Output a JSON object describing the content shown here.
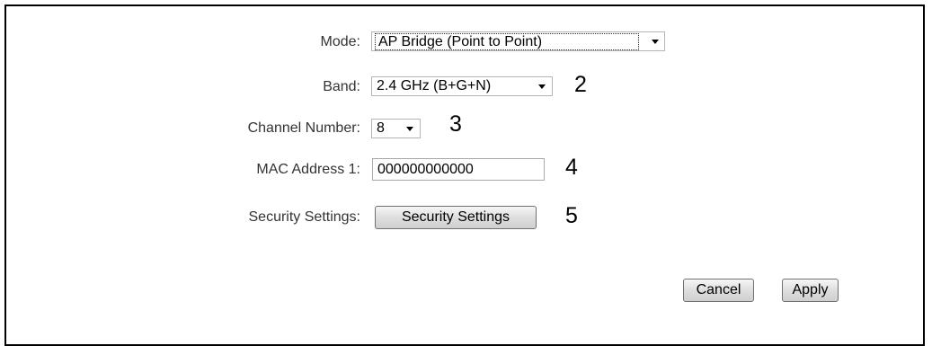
{
  "form": {
    "mode_label": "Mode:",
    "mode_value": "AP Bridge (Point to Point)",
    "band_label": "Band:",
    "band_value": "2.4 GHz (B+G+N)",
    "band_callout": "2",
    "channel_label": "Channel Number:",
    "channel_value": "8",
    "channel_callout": "3",
    "mac_label": "MAC Address 1:",
    "mac_value": "000000000000",
    "mac_callout": "4",
    "security_label": "Security Settings:",
    "security_button": "Security Settings",
    "security_callout": "5"
  },
  "actions": {
    "cancel_label": "Cancel",
    "apply_label": "Apply"
  }
}
